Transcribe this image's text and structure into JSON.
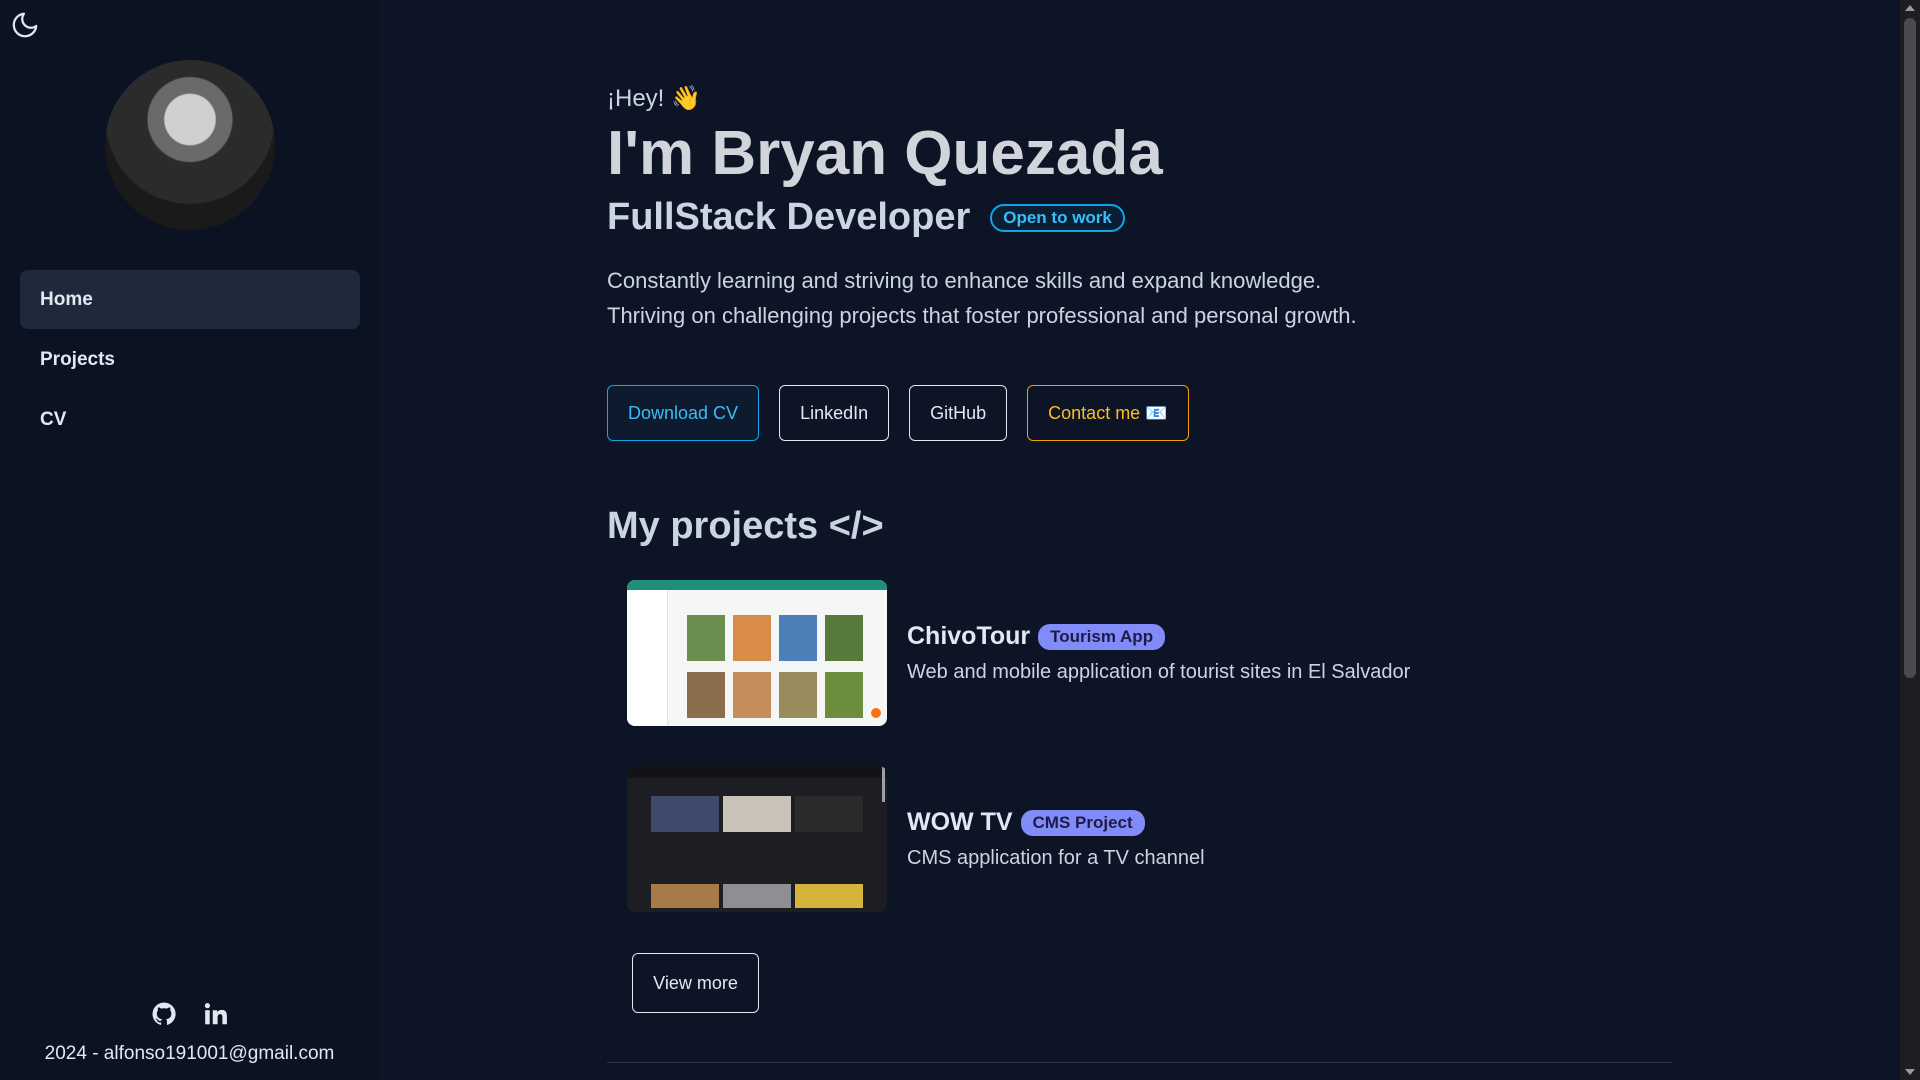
{
  "sidebar": {
    "theme_icon": "moon-icon",
    "nav": [
      {
        "label": "Home",
        "active": true
      },
      {
        "label": "Projects",
        "active": false
      },
      {
        "label": "CV",
        "active": false
      }
    ],
    "social_icons": [
      "github-icon",
      "linkedin-icon"
    ],
    "footer": "2024 - alfonso191001@gmail.com"
  },
  "hero": {
    "greeting": "¡Hey! 👋",
    "name": "I'm Bryan Quezada",
    "role": "FullStack Developer",
    "badge": "Open to work",
    "intro_line1": "Constantly learning and striving to enhance skills and expand knowledge.",
    "intro_line2": "Thriving on challenging projects that foster professional and personal growth."
  },
  "buttons": {
    "download_cv": "Download CV",
    "linkedin": "LinkedIn",
    "github": "GitHub",
    "contact": "Contact me 📧"
  },
  "projects": {
    "title": "My projects </>",
    "items": [
      {
        "title": "ChivoTour",
        "tag": "Tourism App",
        "desc": "Web and mobile application of tourist sites in El Salvador"
      },
      {
        "title": "WOW TV",
        "tag": "CMS Project",
        "desc": "CMS application for a TV channel"
      }
    ],
    "view_more": "View more"
  },
  "colors": {
    "background": "#0d1426",
    "sidebar": "#0b1222",
    "accent_blue": "#38bdf8",
    "accent_amber": "#fbbf24",
    "tag_purple": "#818cf8"
  }
}
